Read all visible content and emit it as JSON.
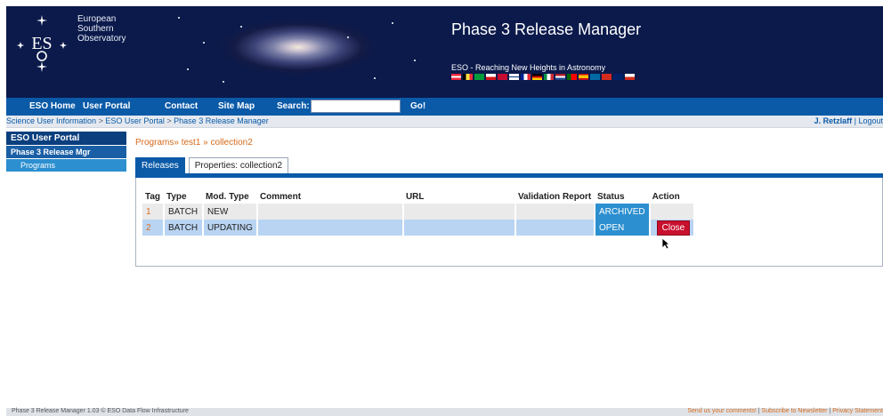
{
  "header": {
    "org_lines": [
      "European",
      "Southern",
      "Observatory"
    ],
    "logo_text": "ESO",
    "app_title": "Phase 3 Release Manager",
    "tagline": "ESO - Reaching New Heights in Astronomy"
  },
  "nav": {
    "items": [
      "ESO Home",
      "User Portal",
      "Contact",
      "Site Map"
    ],
    "search_label": "Search:",
    "search_value": "",
    "go_label": "Go!"
  },
  "breadcrumb": {
    "items": [
      "Science User Information",
      "ESO User Portal",
      "Phase 3 Release Manager"
    ],
    "separator": ">",
    "user_name": "J. Retzlaff",
    "logout": "Logout",
    "user_sep": "|"
  },
  "sidebar": {
    "title": "ESO User Portal",
    "section": "Phase 3 Release Mgr",
    "items": [
      {
        "label": "Programs"
      }
    ]
  },
  "path": {
    "items": [
      "Programs",
      "test1",
      "collection2"
    ],
    "separator": "»"
  },
  "tabs": [
    {
      "label": "Releases",
      "active": true
    },
    {
      "label": "Properties: collection2",
      "active": false
    }
  ],
  "table": {
    "columns": [
      "Tag",
      "Type",
      "Mod. Type",
      "Comment",
      "URL",
      "Validation Report",
      "Status",
      "Action"
    ],
    "rows": [
      {
        "tag": "1",
        "type": "BATCH",
        "mod_type": "NEW",
        "comment": "",
        "url": "",
        "validation": "",
        "status": "ARCHIVED",
        "action": ""
      },
      {
        "tag": "2",
        "type": "BATCH",
        "mod_type": "UPDATING",
        "comment": "",
        "url": "",
        "validation": "",
        "status": "OPEN",
        "action": "Close"
      }
    ]
  },
  "footer": {
    "left": "Phase 3 Release Manager 1.03 © ESO Data Flow Infrastructure",
    "links": [
      "Send us your comments!",
      "Subscribe to Newsletter",
      "Privacy Statement"
    ],
    "separator": "|"
  },
  "colors": {
    "header_bg": "#0b1a4b",
    "nav_bg": "#0a5aa8",
    "accent_orange": "#d46a1b",
    "status_blue": "#2c8fd0",
    "close_red": "#c8102e"
  },
  "icons": [
    "eso-logo-icon",
    "mouse-pointer-icon"
  ]
}
